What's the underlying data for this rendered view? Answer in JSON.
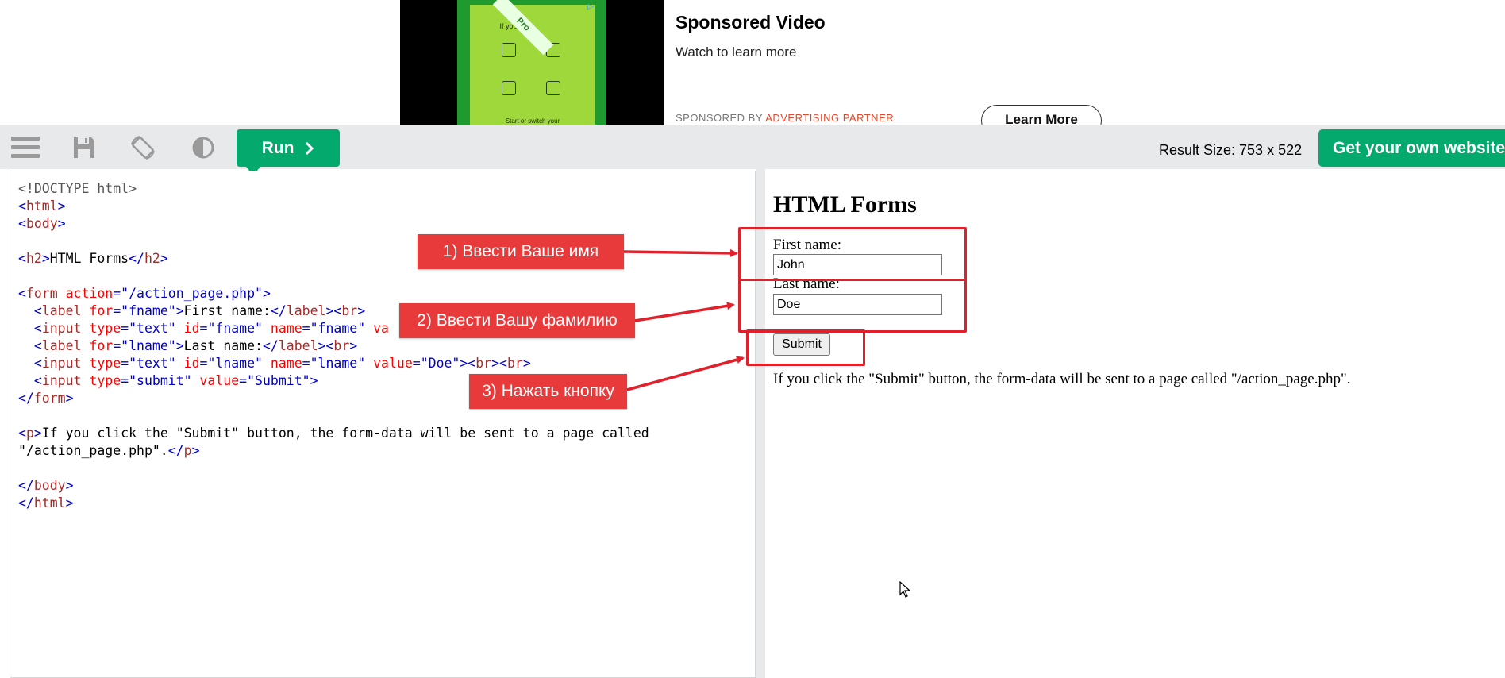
{
  "ad": {
    "thumbnail_heading": "If you are...",
    "thumbnail_badge": "Pro",
    "thumbnail_footer": "Start or switch your",
    "title": "Sponsored Video",
    "subtitle": "Watch to learn more",
    "sponsored_by": "SPONSORED BY",
    "partner": "ADVERTISING PARTNER",
    "cta": "Learn More"
  },
  "toolbar": {
    "run_label": "Run",
    "result_size": "Result Size: 753 x 522",
    "get_website": "Get your own website"
  },
  "code_lines": [
    [
      {
        "c": "c-doc",
        "t": "<!DOCTYPE html>"
      }
    ],
    [
      {
        "c": "c-br",
        "t": "<"
      },
      {
        "c": "c-tag",
        "t": "html"
      },
      {
        "c": "c-br",
        "t": ">"
      }
    ],
    [
      {
        "c": "c-br",
        "t": "<"
      },
      {
        "c": "c-tag",
        "t": "body"
      },
      {
        "c": "c-br",
        "t": ">"
      }
    ],
    [],
    [
      {
        "c": "c-br",
        "t": "<"
      },
      {
        "c": "c-tag",
        "t": "h2"
      },
      {
        "c": "c-br",
        "t": ">"
      },
      {
        "c": "",
        "t": "HTML Forms"
      },
      {
        "c": "c-br",
        "t": "</"
      },
      {
        "c": "c-tag",
        "t": "h2"
      },
      {
        "c": "c-br",
        "t": ">"
      }
    ],
    [],
    [
      {
        "c": "c-br",
        "t": "<"
      },
      {
        "c": "c-tag",
        "t": "form"
      },
      {
        "c": "c-attr",
        "t": " action"
      },
      {
        "c": "c-val",
        "t": "=\"/action_page.php\""
      },
      {
        "c": "c-br",
        "t": ">"
      }
    ],
    [
      {
        "c": "",
        "t": "  "
      },
      {
        "c": "c-br",
        "t": "<"
      },
      {
        "c": "c-tag",
        "t": "label"
      },
      {
        "c": "c-attr",
        "t": " for"
      },
      {
        "c": "c-val",
        "t": "=\"fname\""
      },
      {
        "c": "c-br",
        "t": ">"
      },
      {
        "c": "",
        "t": "First name:"
      },
      {
        "c": "c-br",
        "t": "</"
      },
      {
        "c": "c-tag",
        "t": "label"
      },
      {
        "c": "c-br",
        "t": "><"
      },
      {
        "c": "c-tag",
        "t": "br"
      },
      {
        "c": "c-br",
        "t": ">"
      }
    ],
    [
      {
        "c": "",
        "t": "  "
      },
      {
        "c": "c-br",
        "t": "<"
      },
      {
        "c": "c-tag",
        "t": "input"
      },
      {
        "c": "c-attr",
        "t": " type"
      },
      {
        "c": "c-val",
        "t": "=\"text\""
      },
      {
        "c": "c-attr",
        "t": " id"
      },
      {
        "c": "c-val",
        "t": "=\"fname\""
      },
      {
        "c": "c-attr",
        "t": " name"
      },
      {
        "c": "c-val",
        "t": "=\"fname\""
      },
      {
        "c": "c-attr",
        "t": " va"
      }
    ],
    [
      {
        "c": "",
        "t": "  "
      },
      {
        "c": "c-br",
        "t": "<"
      },
      {
        "c": "c-tag",
        "t": "label"
      },
      {
        "c": "c-attr",
        "t": " for"
      },
      {
        "c": "c-val",
        "t": "=\"lname\""
      },
      {
        "c": "c-br",
        "t": ">"
      },
      {
        "c": "",
        "t": "Last name:"
      },
      {
        "c": "c-br",
        "t": "</"
      },
      {
        "c": "c-tag",
        "t": "label"
      },
      {
        "c": "c-br",
        "t": "><"
      },
      {
        "c": "c-tag",
        "t": "br"
      },
      {
        "c": "c-br",
        "t": ">"
      }
    ],
    [
      {
        "c": "",
        "t": "  "
      },
      {
        "c": "c-br",
        "t": "<"
      },
      {
        "c": "c-tag",
        "t": "input"
      },
      {
        "c": "c-attr",
        "t": " type"
      },
      {
        "c": "c-val",
        "t": "=\"text\""
      },
      {
        "c": "c-attr",
        "t": " id"
      },
      {
        "c": "c-val",
        "t": "=\"lname\""
      },
      {
        "c": "c-attr",
        "t": " name"
      },
      {
        "c": "c-val",
        "t": "=\"lname\""
      },
      {
        "c": "c-attr",
        "t": " value"
      },
      {
        "c": "c-val",
        "t": "=\"Doe\""
      },
      {
        "c": "c-br",
        "t": "><"
      },
      {
        "c": "c-tag",
        "t": "br"
      },
      {
        "c": "c-br",
        "t": "><"
      },
      {
        "c": "c-tag",
        "t": "br"
      },
      {
        "c": "c-br",
        "t": ">"
      }
    ],
    [
      {
        "c": "",
        "t": "  "
      },
      {
        "c": "c-br",
        "t": "<"
      },
      {
        "c": "c-tag",
        "t": "input"
      },
      {
        "c": "c-attr",
        "t": " type"
      },
      {
        "c": "c-val",
        "t": "=\"submit\""
      },
      {
        "c": "c-attr",
        "t": " value"
      },
      {
        "c": "c-val",
        "t": "=\"Submit\""
      },
      {
        "c": "c-br",
        "t": ">"
      }
    ],
    [
      {
        "c": "c-br",
        "t": "</"
      },
      {
        "c": "c-tag",
        "t": "form"
      },
      {
        "c": "c-br",
        "t": ">"
      }
    ],
    [],
    [
      {
        "c": "c-br",
        "t": "<"
      },
      {
        "c": "c-tag",
        "t": "p"
      },
      {
        "c": "c-br",
        "t": ">"
      },
      {
        "c": "",
        "t": "If you click the \"Submit\" button, the form-data will be sent to a page called"
      }
    ],
    [
      {
        "c": "",
        "t": "\"/action_page.php\"."
      },
      {
        "c": "c-br",
        "t": "</"
      },
      {
        "c": "c-tag",
        "t": "p"
      },
      {
        "c": "c-br",
        "t": ">"
      }
    ],
    [],
    [
      {
        "c": "c-br",
        "t": "</"
      },
      {
        "c": "c-tag",
        "t": "body"
      },
      {
        "c": "c-br",
        "t": ">"
      }
    ],
    [
      {
        "c": "c-br",
        "t": "</"
      },
      {
        "c": "c-tag",
        "t": "html"
      },
      {
        "c": "c-br",
        "t": ">"
      }
    ]
  ],
  "result": {
    "heading": "HTML Forms",
    "first_name_label": "First name:",
    "first_name_value": "John",
    "last_name_label": "Last name:",
    "last_name_value": "Doe",
    "submit_label": "Submit",
    "paragraph": "If you click the \"Submit\" button, the form-data will be sent to a page called \"/action_page.php\"."
  },
  "annotations": {
    "step1": "1) Ввести Ваше имя",
    "step2": "2) Ввести Вашу фамилию",
    "step3": "3) Нажать кнопку",
    "color": "#e83a3a"
  },
  "colors": {
    "accent_green": "#04aa6d",
    "toolbar_bg": "#e7e9eb"
  }
}
